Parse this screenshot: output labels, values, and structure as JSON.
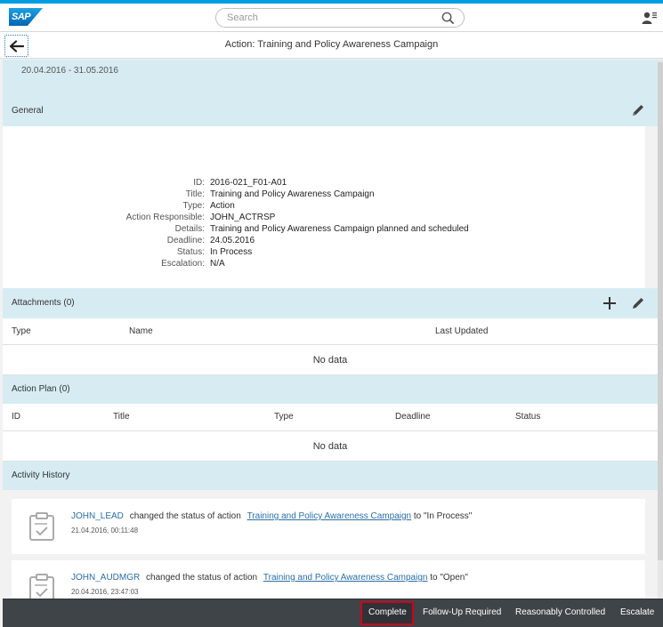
{
  "shell": {
    "logo_text": "SAP",
    "search_placeholder": "Search"
  },
  "header": {
    "title": "Action: Training and Policy Awareness Campaign",
    "date_range": "20.04.2016 - 31.05.2016"
  },
  "general": {
    "section_label": "General",
    "fields": [
      {
        "key": "ID:",
        "value": "2016-021_F01-A01"
      },
      {
        "key": "Title:",
        "value": "Training and Policy Awareness Campaign"
      },
      {
        "key": "Type:",
        "value": "Action"
      },
      {
        "key": "Action Responsible:",
        "value": "JOHN_ACTRSP"
      },
      {
        "key": "Details:",
        "value": "Training and Policy Awareness Campaign planned and scheduled"
      },
      {
        "key": "Deadline:",
        "value": "24.05.2016"
      },
      {
        "key": "Status:",
        "value": "In Process"
      },
      {
        "key": "Escalation:",
        "value": "N/A"
      }
    ]
  },
  "attachments": {
    "section_label": "Attachments (0)",
    "columns": [
      "Type",
      "Name",
      "Last Updated"
    ],
    "empty_text": "No data"
  },
  "action_plan": {
    "section_label": "Action Plan (0)",
    "columns": [
      "ID",
      "Title",
      "Type",
      "Deadline",
      "Status"
    ],
    "empty_text": "No data"
  },
  "activity_history": {
    "section_label": "Activity History",
    "entries": [
      {
        "user": "JOHN_LEAD",
        "text": "changed the status of action",
        "link": "Training and Policy Awareness Campaign",
        "suffix": "to \"In Process\"",
        "time": "21.04.2016, 00:11:48"
      },
      {
        "user": "JOHN_AUDMGR",
        "text": "changed the status of action",
        "link": "Training and Policy Awareness Campaign",
        "suffix": "to \"Open\"",
        "time": "20.04.2016, 23:47:03"
      }
    ]
  },
  "footer": {
    "buttons": [
      "Complete",
      "Follow-Up Required",
      "Reasonably Controlled",
      "Escalate"
    ]
  },
  "colors": {
    "brand": "#009de0",
    "section_header": "#d6ecf2",
    "link": "#2b6ea8",
    "footer_bg": "#3f4449",
    "highlight": "#d0021b"
  }
}
